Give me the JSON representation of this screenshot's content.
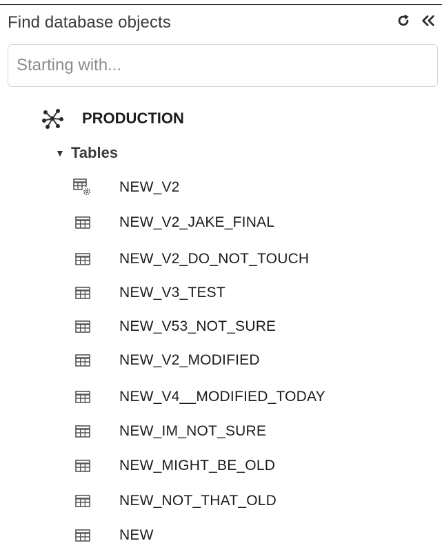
{
  "panel": {
    "title": "Find database objects",
    "refresh_icon": "refresh-icon",
    "collapse_icon": "double-chevron-left-icon"
  },
  "search": {
    "placeholder": "Starting with...",
    "value": ""
  },
  "tree": {
    "database": {
      "label": "PRODUCTION",
      "icon": "database-schema-icon"
    },
    "folder": {
      "label": "Tables",
      "caret": "▼",
      "expanded": true
    },
    "tables": [
      {
        "label": "NEW_V2",
        "icon": "table-settings-icon"
      },
      {
        "label": "NEW_V2_JAKE_FINAL",
        "icon": "table-icon"
      },
      {
        "label": "NEW_V2_DO_NOT_TOUCH",
        "icon": "table-icon"
      },
      {
        "label": "NEW_V3_TEST",
        "icon": "table-icon"
      },
      {
        "label": "NEW_V53_NOT_SURE",
        "icon": "table-icon"
      },
      {
        "label": "NEW_V2_MODIFIED",
        "icon": "table-icon"
      },
      {
        "label": "NEW_V4__MODIFIED_TODAY",
        "icon": "table-icon"
      },
      {
        "label": "NEW_IM_NOT_SURE",
        "icon": "table-icon"
      },
      {
        "label": "NEW_MIGHT_BE_OLD",
        "icon": "table-icon"
      },
      {
        "label": "NEW_NOT_THAT_OLD",
        "icon": "table-icon"
      },
      {
        "label": "NEW",
        "icon": "table-icon"
      }
    ]
  }
}
